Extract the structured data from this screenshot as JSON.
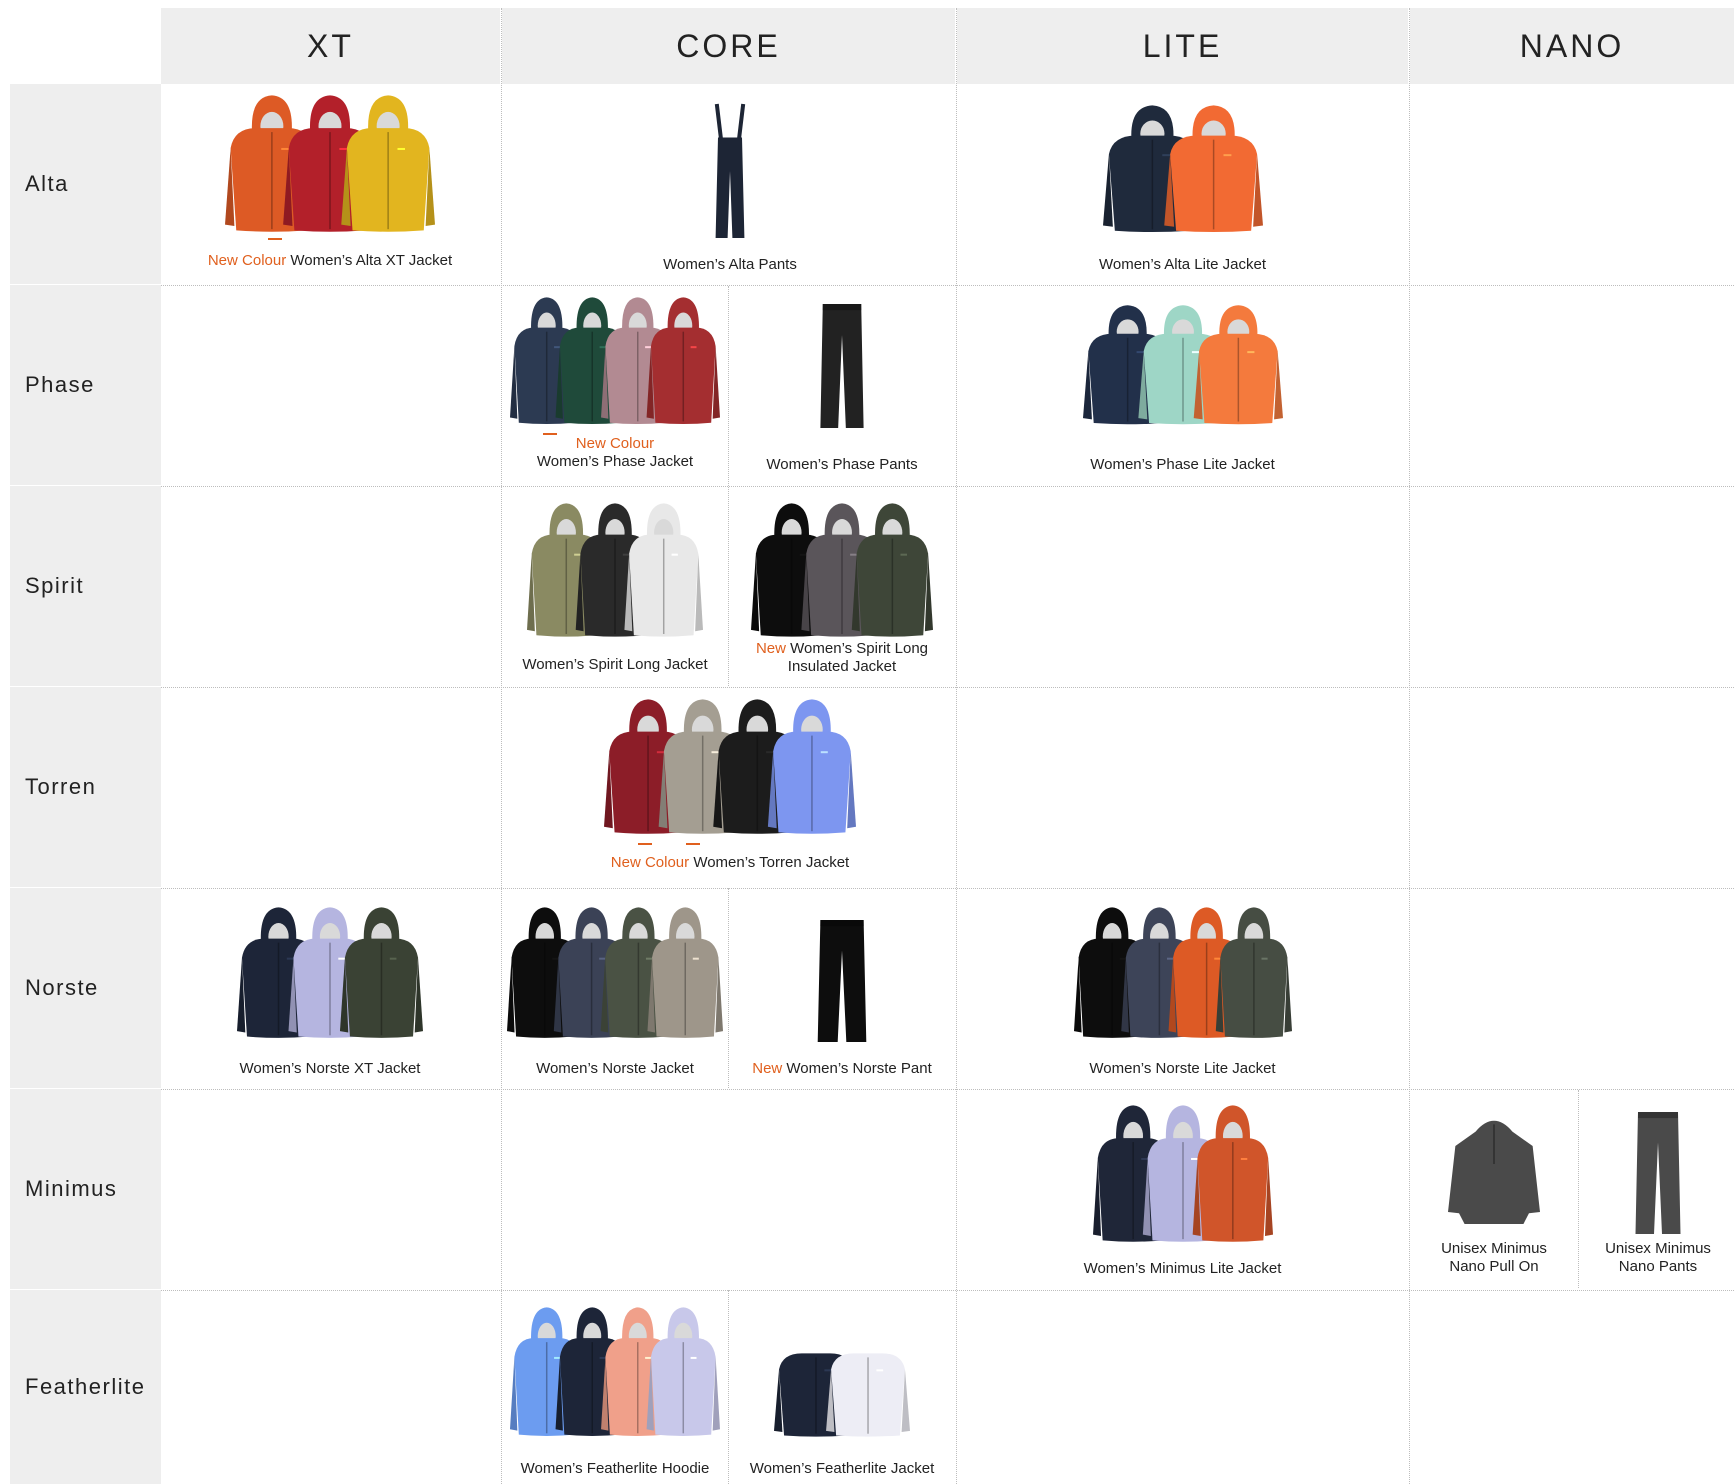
{
  "columns": [
    "XT",
    "CORE",
    "LITE",
    "NANO"
  ],
  "rows": [
    "Alta",
    "Phase",
    "Spirit",
    "Torren",
    "Norste",
    "Minimus",
    "Featherlite"
  ],
  "accent_color": "#e0601e",
  "tags": {
    "new_colour": "New Colour",
    "new": "New"
  },
  "products": {
    "alta_xt": {
      "name": "Women’s Alta XT Jacket",
      "tag": "New Colour"
    },
    "alta_pants": {
      "name": "Women’s Alta Pants"
    },
    "alta_lite": {
      "name": "Women’s Alta Lite Jacket"
    },
    "phase_jacket": {
      "name": "Women’s Phase Jacket",
      "tag": "New Colour"
    },
    "phase_pants": {
      "name": "Women’s Phase Pants"
    },
    "phase_lite": {
      "name": "Women’s Phase Lite Jacket"
    },
    "spirit_long": {
      "name": "Women’s Spirit Long Jacket"
    },
    "spirit_long_insulated": {
      "name_line1": "Women’s Spirit Long",
      "name_line2": "Insulated Jacket",
      "tag": "New"
    },
    "torren": {
      "name": "Women’s Torren Jacket",
      "tag": "New Colour"
    },
    "norste_xt": {
      "name": "Women’s Norste XT Jacket"
    },
    "norste_jacket": {
      "name": "Women’s Norste Jacket"
    },
    "norste_pant": {
      "name": "Women’s Norste Pant",
      "tag": "New"
    },
    "norste_lite": {
      "name": "Women’s Norste Lite Jacket"
    },
    "minimus_lite": {
      "name": "Women’s Minimus Lite Jacket"
    },
    "minimus_nano_pullon": {
      "name_line1": "Unisex Minimus",
      "name_line2": "Nano Pull On"
    },
    "minimus_nano_pants": {
      "name_line1": "Unisex Minimus",
      "name_line2": "Nano Pants"
    },
    "featherlite_hoodie": {
      "name": "Women’s Featherlite Hoodie"
    },
    "featherlite_jacket": {
      "name": "Women’s Featherlite Jacket"
    }
  },
  "swatches": {
    "alta_xt": [
      "#dd5a25",
      "#b3202a",
      "#e2b51f"
    ],
    "alta_pants": [
      "#1d2535"
    ],
    "alta_lite": [
      "#1f2a3c",
      "#f26a33"
    ],
    "phase_jacket": [
      "#2c3a52",
      "#1f4a3a",
      "#b28a92",
      "#a42e30"
    ],
    "phase_pants": [
      "#222222"
    ],
    "phase_lite": [
      "#22304a",
      "#9ed6c6",
      "#f47a3d"
    ],
    "spirit_long": [
      "#8a8a62",
      "#2a2a2a",
      "#e8e8e8"
    ],
    "spirit_long_insulated": [
      "#0d0d0d",
      "#5a555a",
      "#3e4638"
    ],
    "torren": [
      "#8c1d28",
      "#a49e92",
      "#1c1c1c",
      "#7d96f0"
    ],
    "norste_xt": [
      "#1d2538",
      "#b5b5e0",
      "#3a4234"
    ],
    "norste_jacket": [
      "#0d0d0d",
      "#3b4256",
      "#4a5244",
      "#9e968a"
    ],
    "norste_pant": [
      "#0d0d0d"
    ],
    "norste_lite": [
      "#0d0d0d",
      "#3d4458",
      "#dd5a25",
      "#464d43"
    ],
    "minimus_lite": [
      "#1f2638",
      "#b5b5e0",
      "#d0552a"
    ],
    "minimus_nano_pullon": [
      "#4a4a4a"
    ],
    "minimus_nano_pants": [
      "#4a4a4a"
    ],
    "featherlite_hoodie": [
      "#6c9cf0",
      "#1d2538",
      "#f0a08a",
      "#c8c8ea"
    ],
    "featherlite_jacket": [
      "#1d2538",
      "#ededf5"
    ]
  }
}
